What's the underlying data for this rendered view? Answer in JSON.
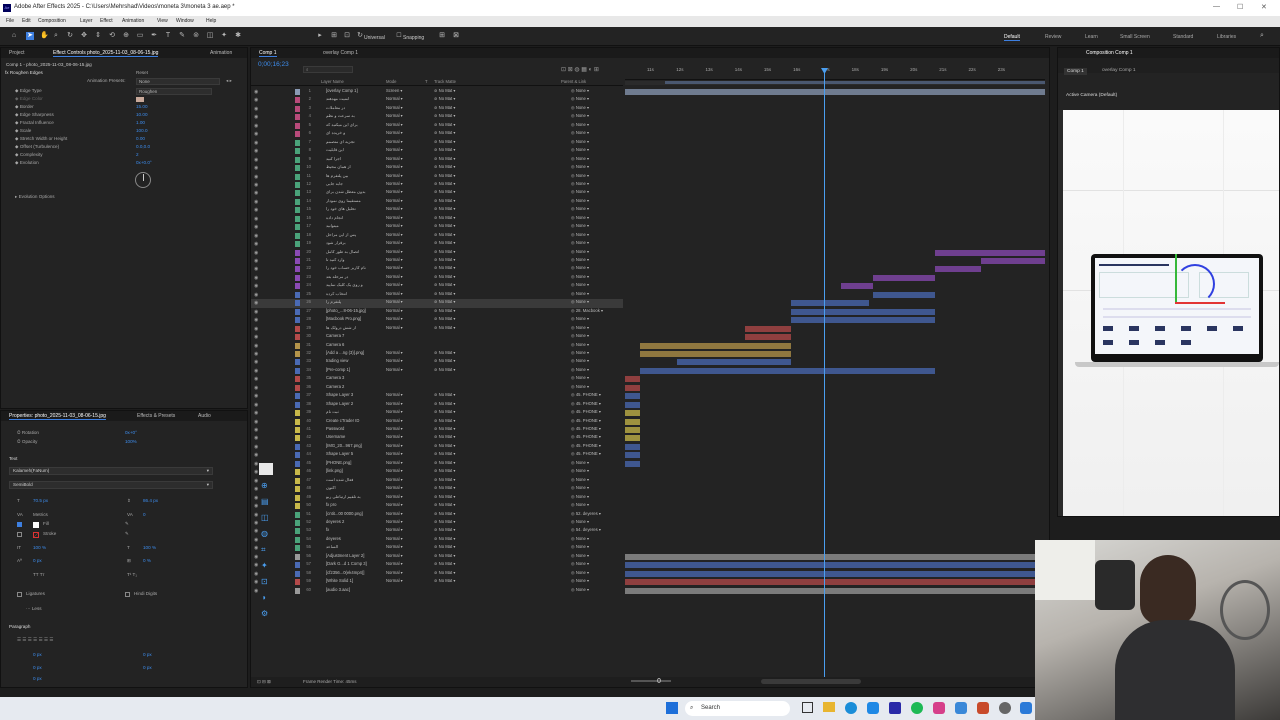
{
  "window": {
    "title": "Adobe After Effects 2025 - C:\\Users\\Mehrshad\\Videos\\moneta 3\\moneta 3 ae.aep *",
    "app_icon": "Ae"
  },
  "menu": [
    "File",
    "Edit",
    "Composition",
    "Layer",
    "Effect",
    "Animation",
    "View",
    "Window",
    "Help"
  ],
  "toolbar": {
    "universal": "Universal",
    "snapping": "Snapping",
    "workspaces": [
      "Default",
      "Review",
      "Learn",
      "Small Screen",
      "Standard",
      "Libraries"
    ]
  },
  "effect_controls": {
    "tabs": [
      "Project",
      "Effect Controls photo_2025-11-03_08-06-15.jpg",
      "Animation"
    ],
    "layer": "Comp 1 - photo_2025-11-03_08-06-15.jpg",
    "effect_name": "Roughen Edges",
    "reset": "Reset",
    "presets_label": "Animation Presets:",
    "presets_value": "None",
    "properties": [
      {
        "name": "Edge Type",
        "value": "Roughen"
      },
      {
        "name": "Edge Color",
        "value": ""
      },
      {
        "name": "Border",
        "value": "15.00"
      },
      {
        "name": "Edge Sharpness",
        "value": "10.00"
      },
      {
        "name": "Fractal Influence",
        "value": "1.00"
      },
      {
        "name": "Scale",
        "value": "100.0"
      },
      {
        "name": "Stretch Width or Height",
        "value": "0.00"
      },
      {
        "name": "Offset (Turbulence)",
        "value": "0.0,0.0"
      },
      {
        "name": "Complexity",
        "value": "2"
      },
      {
        "name": "Evolution",
        "value": "0x+0.0°"
      }
    ],
    "evolution_options": "Evolution Options"
  },
  "properties_panel": {
    "tabs": [
      "Properties: photo_2025-11-03_08-06-15.jpg",
      "Effects & Presets",
      "Audio"
    ],
    "rotation_label": "Rotation",
    "rotation_value": "0x+0°",
    "opacity_label": "Opacity",
    "opacity_value": "100%",
    "text_section": "Text",
    "font": "Kalameh(FaNum)",
    "style": "SemiBold",
    "font_size": "70.5 px",
    "leading": "86.4 px",
    "kerning": "Metrics",
    "tracking": "0",
    "fill": "Fill",
    "stroke": "Stroke",
    "vscale": "100 %",
    "hscale": "100 %",
    "baseline": "0 px",
    "tsume": "0 %",
    "ligatures": "Ligatures",
    "hindi_digits": "Hindi Digits",
    "less": "Less",
    "paragraph": "Paragraph",
    "indent1": "0 px",
    "indent2": "0 px",
    "indent3": "0 px",
    "space1": "0 px",
    "space2": "0 px"
  },
  "timeline": {
    "tabs": [
      "Comp 1",
      "overlay Comp 1"
    ],
    "timecode": "0;00;16;23",
    "columns": [
      "Layer Name",
      "Mode",
      "T",
      "Track Matte",
      "Parent & Link"
    ],
    "ruler": [
      "11s",
      "12s",
      "13s",
      "14s",
      "15s",
      "16s",
      "17s",
      "18s",
      "19s",
      "20s",
      "21s",
      "22s",
      "23s"
    ],
    "frame_render": "Frame Render Time: 45ms",
    "layers": [
      {
        "n": "1",
        "name": "[overlay Comp 1]",
        "mode": "Screen",
        "matte": "No Mat",
        "parent": "None",
        "color": "#8a9ab4"
      },
      {
        "n": "2",
        "name": "امنیت مهدهند",
        "mode": "Normal",
        "matte": "No Mat",
        "parent": "None",
        "color": "#b84a7a"
      },
      {
        "n": "3",
        "name": "در معاملات",
        "mode": "Normal",
        "matte": "No Mat",
        "parent": "None",
        "color": "#b84a7a"
      },
      {
        "n": "4",
        "name": "به سرعت و نظم",
        "mode": "Normal",
        "matte": "No Mat",
        "parent": "None",
        "color": "#b84a7a"
      },
      {
        "n": "5",
        "name": "برای این میکنید که",
        "mode": "Normal",
        "matte": "No Mat",
        "parent": "None",
        "color": "#b84a7a"
      },
      {
        "n": "6",
        "name": "و خریده ای",
        "mode": "Normal",
        "matte": "No Mat",
        "parent": "None",
        "color": "#b84a7a"
      },
      {
        "n": "7",
        "name": "تجزیه ای متصمم",
        "mode": "Normal",
        "matte": "No Mat",
        "parent": "None",
        "color": "#4aa37a"
      },
      {
        "n": "8",
        "name": "این قابلیت",
        "mode": "Normal",
        "matte": "No Mat",
        "parent": "None",
        "color": "#4aa37a"
      },
      {
        "n": "9",
        "name": "اجرا کنید",
        "mode": "Normal",
        "matte": "No Mat",
        "parent": "None",
        "color": "#4aa37a"
      },
      {
        "n": "10",
        "name": "از همان محیط",
        "mode": "Normal",
        "matte": "No Mat",
        "parent": "None",
        "color": "#4aa37a"
      },
      {
        "n": "11",
        "name": "بین پلتفرم ها",
        "mode": "Normal",
        "matte": "No Mat",
        "parent": "None",
        "color": "#4aa37a"
      },
      {
        "n": "12",
        "name": "جابه جایی",
        "mode": "Normal",
        "matte": "No Mat",
        "parent": "None",
        "color": "#4aa37a"
      },
      {
        "n": "13",
        "name": "بدون معطل شدن برای",
        "mode": "Normal",
        "matte": "No Mat",
        "parent": "None",
        "color": "#4aa37a"
      },
      {
        "n": "14",
        "name": "مستقیما روی نمودار",
        "mode": "Normal",
        "matte": "No Mat",
        "parent": "None",
        "color": "#4aa37a"
      },
      {
        "n": "15",
        "name": "تحلیل های خود را",
        "mode": "Normal",
        "matte": "No Mat",
        "parent": "None",
        "color": "#4aa37a"
      },
      {
        "n": "16",
        "name": "انجام داده",
        "mode": "Normal",
        "matte": "No Mat",
        "parent": "None",
        "color": "#4aa37a"
      },
      {
        "n": "17",
        "name": "میتوانید",
        "mode": "Normal",
        "matte": "No Mat",
        "parent": "None",
        "color": "#4aa37a"
      },
      {
        "n": "18",
        "name": "پس از این مراحل",
        "mode": "Normal",
        "matte": "No Mat",
        "parent": "None",
        "color": "#4aa37a"
      },
      {
        "n": "19",
        "name": "برقرار شود",
        "mode": "Normal",
        "matte": "No Mat",
        "parent": "None",
        "color": "#4aa37a"
      },
      {
        "n": "20",
        "name": "اتصال به طور کامل",
        "mode": "Normal",
        "matte": "No Mat",
        "parent": "None",
        "color": "#8a4ab4"
      },
      {
        "n": "21",
        "name": "وارد کنید تا",
        "mode": "Normal",
        "matte": "No Mat",
        "parent": "None",
        "color": "#8a4ab4"
      },
      {
        "n": "22",
        "name": "نام کاربر حساب خود را",
        "mode": "Normal",
        "matte": "No Mat",
        "parent": "None",
        "color": "#8a4ab4"
      },
      {
        "n": "23",
        "name": "در مرحله بعد",
        "mode": "Normal",
        "matte": "No Mat",
        "parent": "None",
        "color": "#8a4ab4"
      },
      {
        "n": "24",
        "name": "و روی یک کلیک نمایید",
        "mode": "Normal",
        "matte": "No Mat",
        "parent": "None",
        "color": "#8a4ab4"
      },
      {
        "n": "25",
        "name": "انتخاب کرده",
        "mode": "Normal",
        "matte": "No Mat",
        "parent": "None",
        "color": "#4a6ab4"
      },
      {
        "n": "26",
        "name": "پلتفرم را",
        "mode": "Normal",
        "matte": "No Mat",
        "parent": "None",
        "color": "#4a6ab4"
      },
      {
        "n": "27",
        "name": "[photo_...8-06-15.jpg]",
        "mode": "Normal",
        "matte": "No Mat",
        "parent": "28. Macbook",
        "color": "#4a6ab4"
      },
      {
        "n": "28",
        "name": "[Macbook Pro.png]",
        "mode": "Normal",
        "matte": "No Mat",
        "parent": "None",
        "color": "#4a6ab4"
      },
      {
        "n": "29",
        "name": "از شش درولک ها",
        "mode": "Normal",
        "matte": "No Mat",
        "parent": "None",
        "color": "#b44a4a"
      },
      {
        "n": "30",
        "name": "Camera 7",
        "mode": "",
        "matte": "",
        "parent": "None",
        "color": "#b44a4a"
      },
      {
        "n": "31",
        "name": "Camera 6",
        "mode": "",
        "matte": "",
        "parent": "None",
        "color": "#b4944a"
      },
      {
        "n": "32",
        "name": "[Add a ...ng (3)].png]",
        "mode": "Normal",
        "matte": "No Mat",
        "parent": "None",
        "color": "#b4944a"
      },
      {
        "n": "33",
        "name": "trading view",
        "mode": "Normal",
        "matte": "No Mat",
        "parent": "None",
        "color": "#4a6ab4"
      },
      {
        "n": "34",
        "name": "[Pre-comp 1]",
        "mode": "Normal",
        "matte": "No Mat",
        "parent": "None",
        "color": "#4a6ab4"
      },
      {
        "n": "35",
        "name": "Camera 3",
        "mode": "",
        "matte": "",
        "parent": "None",
        "color": "#b44a4a"
      },
      {
        "n": "36",
        "name": "Camera 2",
        "mode": "",
        "matte": "",
        "parent": "None",
        "color": "#b44a4a"
      },
      {
        "n": "37",
        "name": "Shape Layer 3",
        "mode": "Normal",
        "matte": "No Mat",
        "parent": "45. PHONE",
        "color": "#4a6ab4"
      },
      {
        "n": "38",
        "name": "Shape Layer 2",
        "mode": "Normal",
        "matte": "No Mat",
        "parent": "45. PHONE",
        "color": "#4a6ab4"
      },
      {
        "n": "39",
        "name": "ثبت نام",
        "mode": "Normal",
        "matte": "No Mat",
        "parent": "45. PHONE",
        "color": "#c8b84a"
      },
      {
        "n": "40",
        "name": "Create cTrader ID",
        "mode": "Normal",
        "matte": "No Mat",
        "parent": "45. PHONE",
        "color": "#c8b84a"
      },
      {
        "n": "41",
        "name": "Password",
        "mode": "Normal",
        "matte": "No Mat",
        "parent": "45. PHONE",
        "color": "#c8b84a"
      },
      {
        "n": "42",
        "name": "Username",
        "mode": "Normal",
        "matte": "No Mat",
        "parent": "45. PHONE",
        "color": "#c8b84a"
      },
      {
        "n": "43",
        "name": "[IMG_20...967.png]",
        "mode": "Normal",
        "matte": "No Mat",
        "parent": "45. PHONE",
        "color": "#4a6ab4"
      },
      {
        "n": "44",
        "name": "Shape Layer 5",
        "mode": "Normal",
        "matte": "No Mat",
        "parent": "45. PHONE",
        "color": "#4a6ab4"
      },
      {
        "n": "45",
        "name": "[PHONE.png]",
        "mode": "Normal",
        "matte": "No Mat",
        "parent": "None",
        "color": "#4a6ab4"
      },
      {
        "n": "46",
        "name": "[link.png]",
        "mode": "Normal",
        "matte": "No Mat",
        "parent": "None",
        "color": "#c8b84a"
      },
      {
        "n": "47",
        "name": "فعال شده است",
        "mode": "Normal",
        "matte": "No Mat",
        "parent": "None",
        "color": "#c8b84a"
      },
      {
        "n": "48",
        "name": "اکنون",
        "mode": "Normal",
        "matte": "No Mat",
        "parent": "None",
        "color": "#c8b84a"
      },
      {
        "n": "49",
        "name": "به تلفیم ارتباطی ربو",
        "mode": "Normal",
        "matte": "No Mat",
        "parent": "None",
        "color": "#c8b84a"
      },
      {
        "n": "50",
        "name": "fx pro",
        "mode": "Normal",
        "matte": "No Mat",
        "parent": "None",
        "color": "#c8b84a"
      },
      {
        "n": "51",
        "name": "[cntit...00 0000.png]",
        "mode": "Normal",
        "matte": "No Mat",
        "parent": "52. deyeres",
        "color": "#4aa37a"
      },
      {
        "n": "52",
        "name": "deyeres 2",
        "mode": "Normal",
        "matte": "No Mat",
        "parent": "None",
        "color": "#4aa37a"
      },
      {
        "n": "53",
        "name": "fx",
        "mode": "Normal",
        "matte": "No Mat",
        "parent": "54. deyeres",
        "color": "#4aa37a"
      },
      {
        "n": "54",
        "name": "deyeres",
        "mode": "Normal",
        "matte": "No Mat",
        "parent": "None",
        "color": "#4aa37a"
      },
      {
        "n": "55",
        "name": "الساعد",
        "mode": "Normal",
        "matte": "No Mat",
        "parent": "None",
        "color": "#4aa37a"
      },
      {
        "n": "56",
        "name": "[Adjustment Layer 2]",
        "mode": "Normal",
        "matte": "No Mat",
        "parent": "None",
        "color": "#9a9a9a"
      },
      {
        "n": "57",
        "name": "[Dark G...d 1 Comp 3]",
        "mode": "Normal",
        "matte": "No Mat",
        "parent": "None",
        "color": "#4a6ab4"
      },
      {
        "n": "58",
        "name": "[cf2356...0(ek4mp4)]",
        "mode": "Normal",
        "matte": "No Mat",
        "parent": "None",
        "color": "#4a6ab4"
      },
      {
        "n": "59",
        "name": "[White Solid 1]",
        "mode": "Normal",
        "matte": "No Mat",
        "parent": "None",
        "color": "#b44a4a"
      },
      {
        "n": "60",
        "name": "[audio 3.aac]",
        "mode": "",
        "matte": "",
        "parent": "None",
        "color": "#9a9a9a"
      }
    ]
  },
  "composition": {
    "tab": "Composition Comp 1",
    "subtabs": [
      "Comp 1",
      "overlay Comp 1"
    ],
    "camera": "Active Camera (Default)"
  },
  "taskbar": {
    "search": "Search"
  }
}
